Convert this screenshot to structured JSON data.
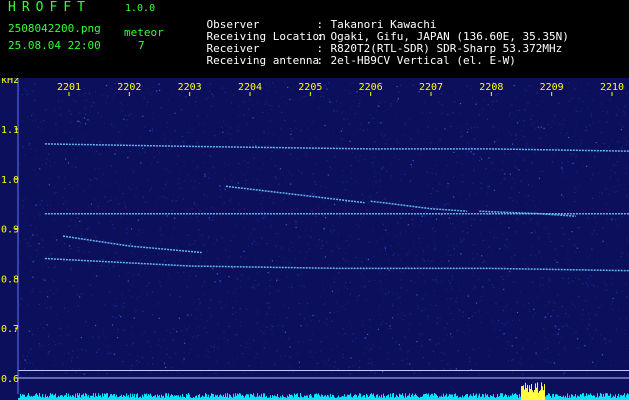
{
  "header": {
    "brand": "HROFFT",
    "version": "1.0.0",
    "filename": "2508042200.png",
    "datetime": "25.08.04 22:00",
    "mode_label": "meteor",
    "count": "7",
    "info": [
      {
        "key": "Observer",
        "value": "Takanori Kawachi"
      },
      {
        "key": "Receiving Location",
        "value": "Ogaki, Gifu, JAPAN (136.60E, 35.35N)"
      },
      {
        "key": "Receiver",
        "value": "R820T2(RTL-SDR) SDR-Sharp 53.372MHz"
      },
      {
        "key": "Receiving antenna",
        "value": "2el-HB9CV Vertical (el. E-W)"
      }
    ]
  },
  "colors": {
    "background": "#0b0f5c",
    "label": "#ffff00",
    "trace": "#6ec8ff",
    "bar": "#00e5ff"
  },
  "chart_data": {
    "type": "heatmap",
    "ylabel": "kHz",
    "ylim": [
      0.58,
      1.2
    ],
    "yticks": [
      "1.1",
      "1.0",
      "0.9",
      "0.8",
      "0.7",
      "0.6"
    ],
    "ytick_values": [
      1.1,
      1.0,
      0.9,
      0.8,
      0.7,
      0.6
    ],
    "xticks": [
      "2201",
      "2202",
      "2203",
      "2204",
      "2205",
      "2206",
      "2207",
      "2208",
      "2209",
      "2210"
    ],
    "xtick_values": [
      2201,
      2202,
      2203,
      2204,
      2205,
      2206,
      2207,
      2208,
      2209,
      2210
    ],
    "xlim": [
      2200.6,
      2210.5
    ],
    "traces": [
      {
        "points": [
          [
            2200.6,
            1.07
          ],
          [
            2203,
            1.065
          ],
          [
            2206,
            1.06
          ],
          [
            2208,
            1.06
          ],
          [
            2210.5,
            1.055
          ]
        ]
      },
      {
        "points": [
          [
            2200.6,
            0.93
          ],
          [
            2210.5,
            0.93
          ]
        ]
      },
      {
        "points": [
          [
            2200.6,
            0.84
          ],
          [
            2203,
            0.825
          ],
          [
            2205.5,
            0.82
          ],
          [
            2208,
            0.82
          ],
          [
            2210.5,
            0.815
          ]
        ]
      },
      {
        "points": [
          [
            2200.9,
            0.885
          ],
          [
            2202,
            0.865
          ],
          [
            2203.2,
            0.852
          ]
        ]
      },
      {
        "points": [
          [
            2203.6,
            0.985
          ],
          [
            2205,
            0.965
          ],
          [
            2205.9,
            0.952
          ]
        ]
      },
      {
        "points": [
          [
            2206,
            0.955
          ],
          [
            2207,
            0.94
          ],
          [
            2207.6,
            0.935
          ]
        ]
      },
      {
        "points": [
          [
            2207.8,
            0.935
          ],
          [
            2208.8,
            0.93
          ],
          [
            2209.4,
            0.925
          ]
        ]
      }
    ],
    "reference_lines": [
      0.615,
      0.6
    ]
  }
}
